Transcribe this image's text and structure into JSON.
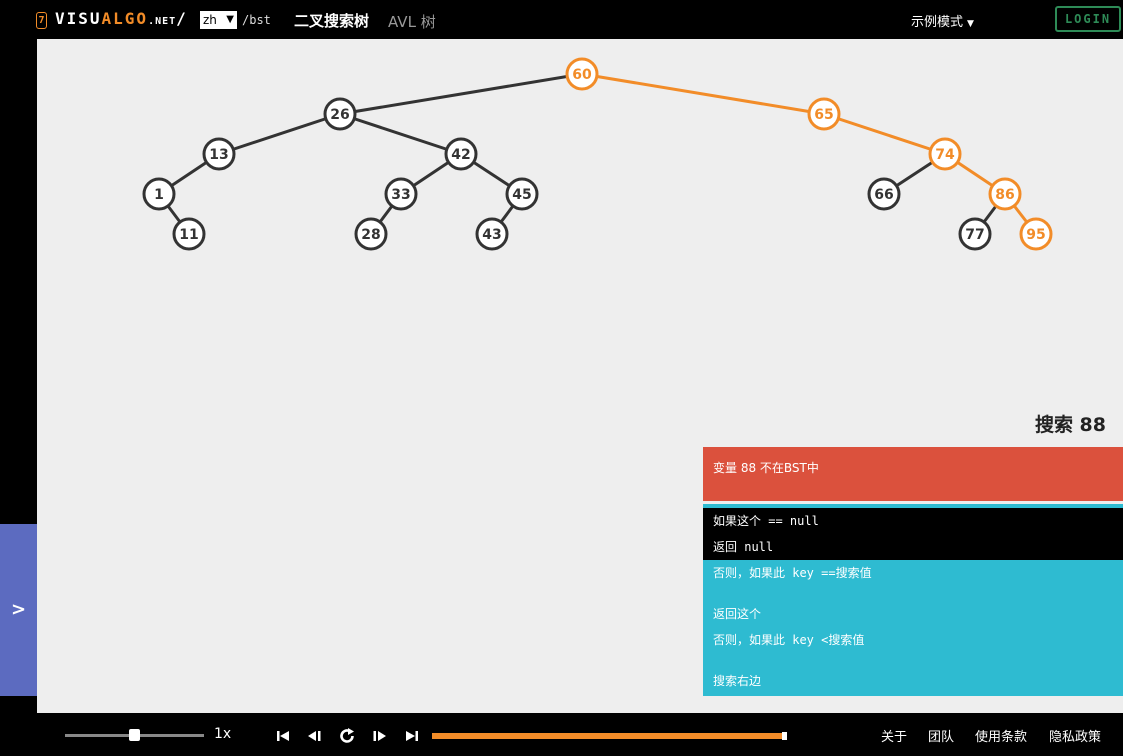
{
  "header": {
    "logo_badge": "7",
    "logo_visu": "VISU",
    "logo_algo": "ALGO",
    "logo_net": ".NET",
    "logo_slash": "/",
    "language": "zh",
    "path": "/bst",
    "title_bst": "二叉搜索树",
    "title_avl": "AVL 树",
    "example_mode": "示例模式",
    "login": "LOGIN"
  },
  "side_toggle": ">",
  "tree": {
    "default_color": "#333333",
    "highlight_color": "#f28c28",
    "nodes": [
      {
        "key": "60",
        "highlighted": true
      },
      {
        "key": "26",
        "highlighted": false
      },
      {
        "key": "65",
        "highlighted": true
      },
      {
        "key": "13",
        "highlighted": false
      },
      {
        "key": "42",
        "highlighted": false
      },
      {
        "key": "74",
        "highlighted": true
      },
      {
        "key": "1",
        "highlighted": false
      },
      {
        "key": "33",
        "highlighted": false
      },
      {
        "key": "45",
        "highlighted": false
      },
      {
        "key": "66",
        "highlighted": false
      },
      {
        "key": "86",
        "highlighted": true
      },
      {
        "key": "11",
        "highlighted": false
      },
      {
        "key": "28",
        "highlighted": false
      },
      {
        "key": "43",
        "highlighted": false
      },
      {
        "key": "77",
        "highlighted": false
      },
      {
        "key": "95",
        "highlighted": true
      }
    ],
    "edges": [
      {
        "from": "60",
        "to": "26",
        "highlighted": false
      },
      {
        "from": "60",
        "to": "65",
        "highlighted": true
      },
      {
        "from": "26",
        "to": "13",
        "highlighted": false
      },
      {
        "from": "26",
        "to": "42",
        "highlighted": false
      },
      {
        "from": "65",
        "to": "74",
        "highlighted": true
      },
      {
        "from": "13",
        "to": "1",
        "highlighted": false
      },
      {
        "from": "42",
        "to": "33",
        "highlighted": false
      },
      {
        "from": "42",
        "to": "45",
        "highlighted": false
      },
      {
        "from": "74",
        "to": "66",
        "highlighted": false
      },
      {
        "from": "74",
        "to": "86",
        "highlighted": true
      },
      {
        "from": "1",
        "to": "11",
        "highlighted": false
      },
      {
        "from": "33",
        "to": "28",
        "highlighted": false
      },
      {
        "from": "45",
        "to": "43",
        "highlighted": false
      },
      {
        "from": "86",
        "to": "77",
        "highlighted": false
      },
      {
        "from": "86",
        "to": "95",
        "highlighted": true
      }
    ]
  },
  "panel": {
    "operation_title": "搜索 88",
    "status": "变量 88 不在BST中",
    "code_lines": [
      {
        "text": "如果这个 == null",
        "active": true
      },
      {
        "text": "返回 null",
        "active": true
      },
      {
        "text": "否则，如果此 key ==搜索值",
        "active": false
      },
      {
        "text": "返回这个",
        "active": false
      },
      {
        "text": "否则，如果此 key <搜索值",
        "active": false
      },
      {
        "text": "搜索右边",
        "active": false
      }
    ]
  },
  "controls": {
    "speed": 0.5,
    "speed_label": "1x",
    "progress": 1.0,
    "icons": [
      "skip-to-start-icon",
      "step-back-icon",
      "replay-icon",
      "step-forward-icon",
      "skip-to-end-icon"
    ]
  },
  "footer": {
    "about": "关于",
    "team": "团队",
    "terms": "使用条款",
    "privacy": "隐私政策"
  }
}
